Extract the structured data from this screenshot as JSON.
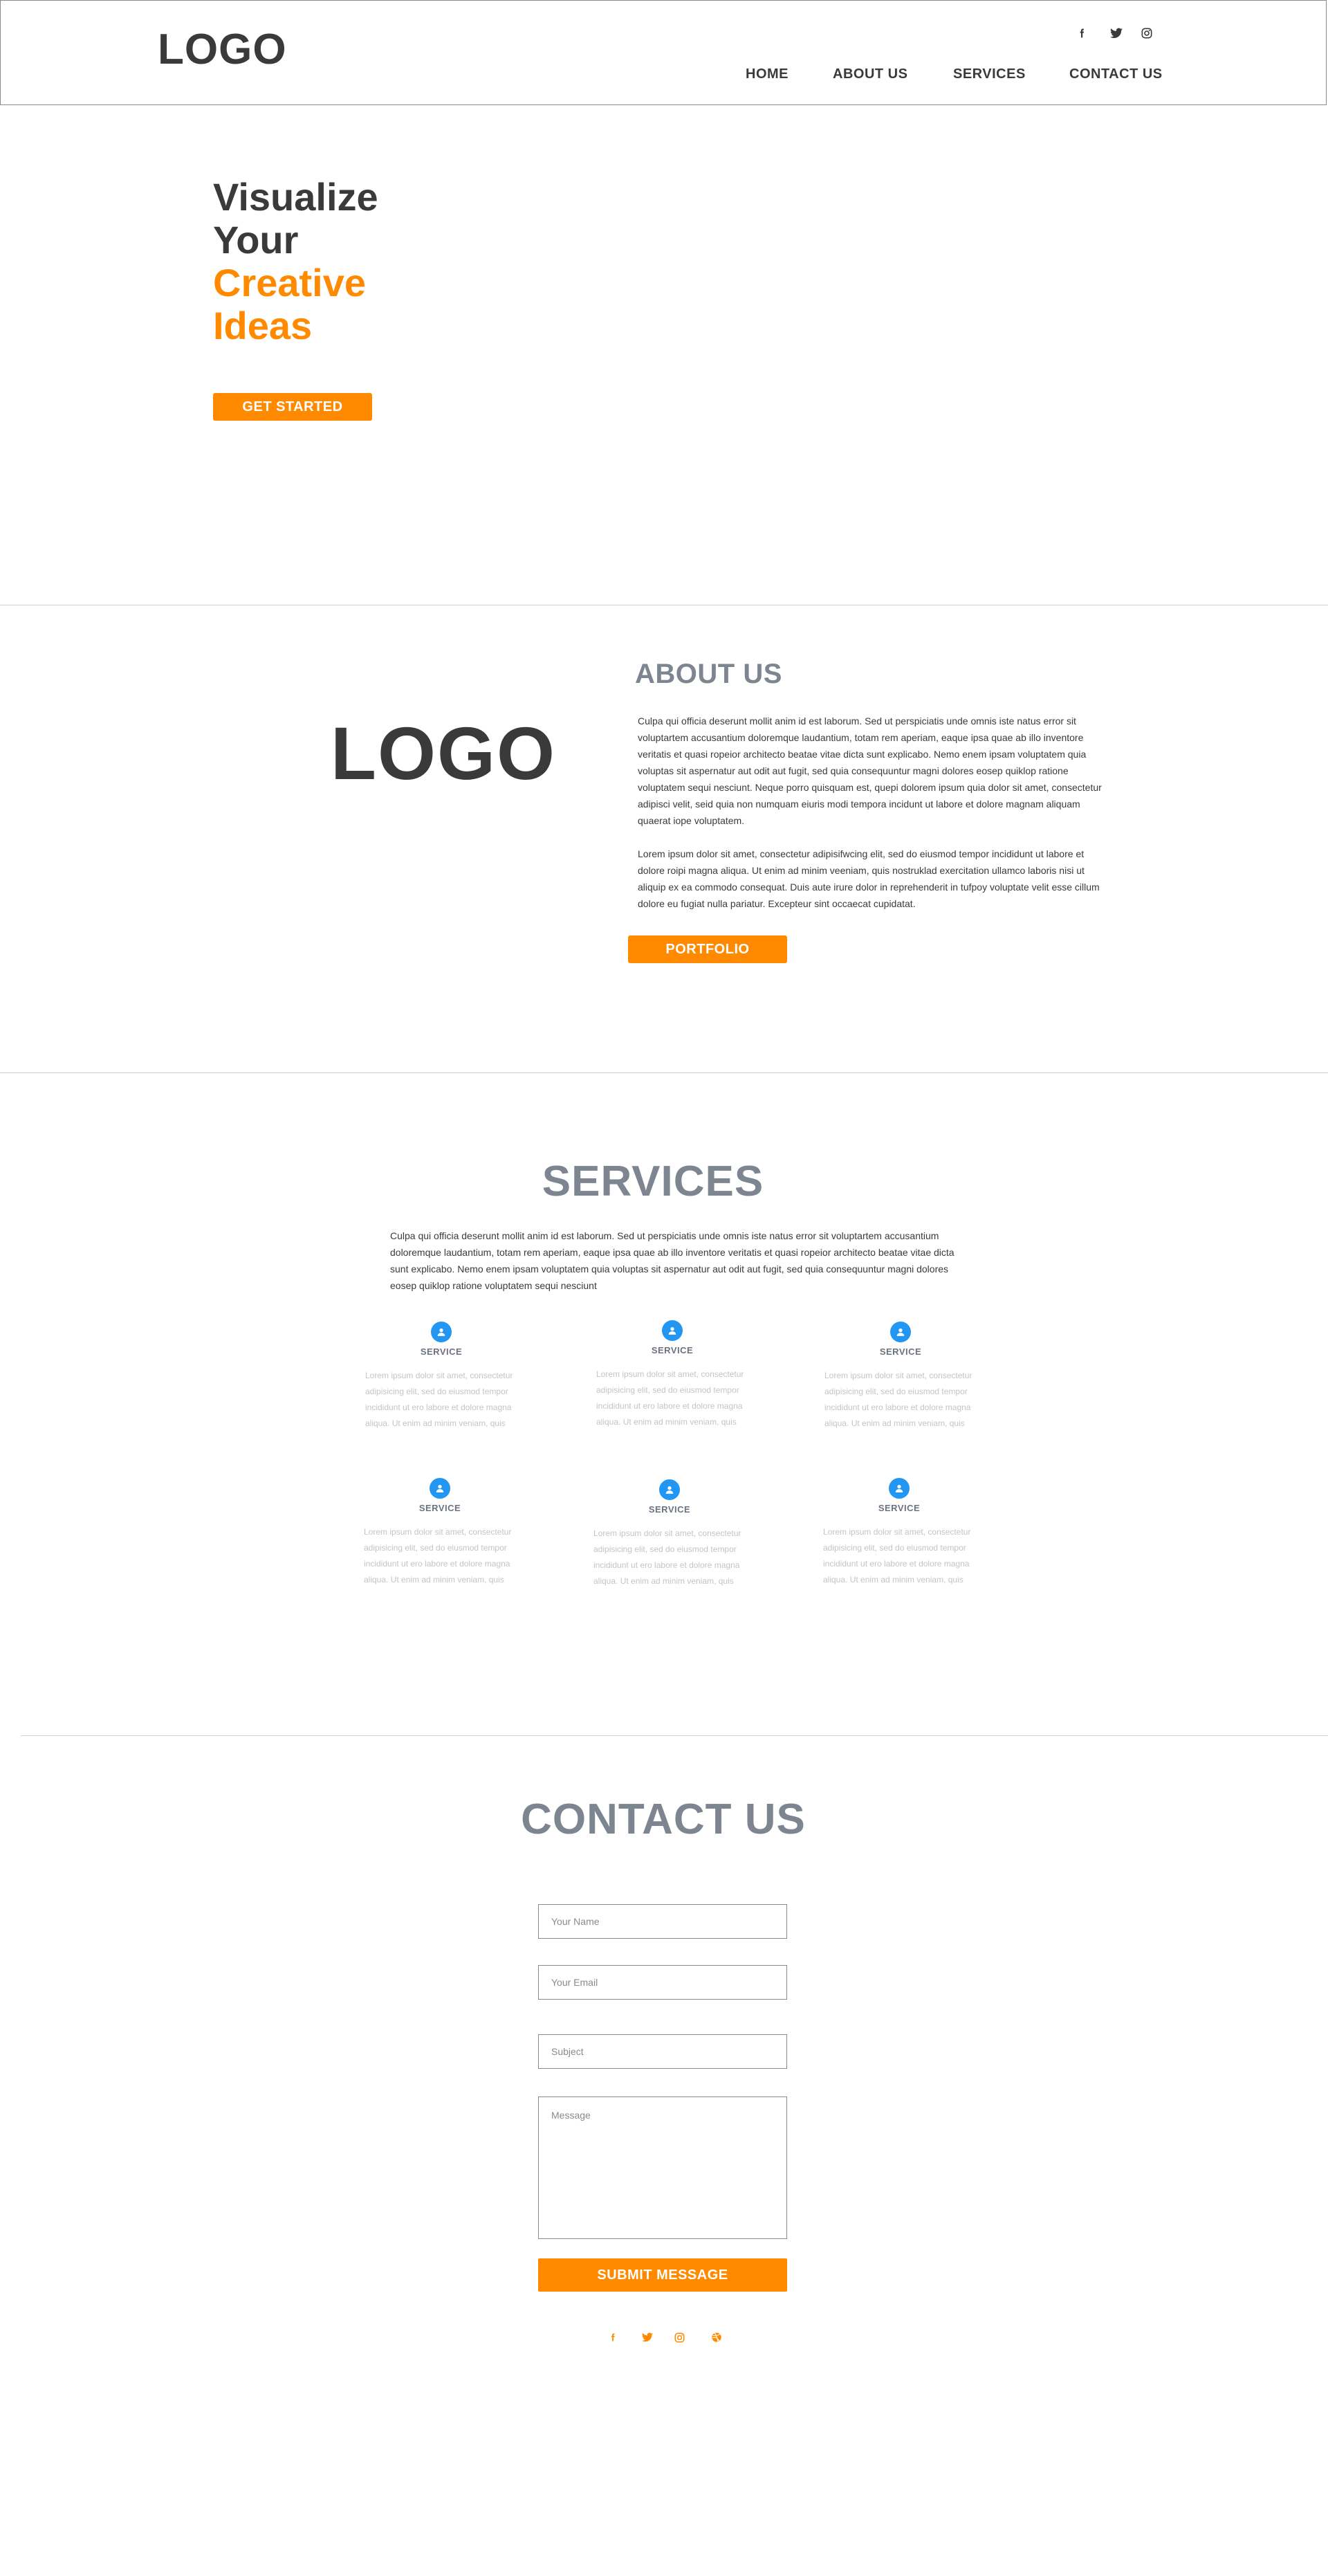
{
  "colors": {
    "accent": "#ff8a00",
    "text_dark": "#3a3a3a",
    "heading_gray": "#7d8590",
    "icon_blue": "#2196f3"
  },
  "header": {
    "logo": "LOGO",
    "nav": [
      "HOME",
      "ABOUT US",
      "SERVICES",
      "CONTACT US"
    ],
    "social_icons": [
      "facebook-icon",
      "twitter-icon",
      "instagram-icon"
    ]
  },
  "hero": {
    "line1": "Visualize",
    "line2": "Your",
    "line3": "Creative",
    "line4": "Ideas",
    "cta": "GET STARTED"
  },
  "about": {
    "logo": "LOGO",
    "title": "ABOUT US",
    "paragraph1": "Culpa qui officia deserunt mollit anim id est laborum. Sed ut perspiciatis unde omnis iste natus error sit voluptartem accusantium doloremque laudantium, totam rem aperiam, eaque ipsa quae ab illo inventore veritatis et quasi ropeior architecto beatae vitae dicta sunt explicabo. Nemo enem ipsam voluptatem quia voluptas sit aspernatur aut odit aut fugit, sed quia consequuntur magni dolores eosep quiklop ratione voluptatem sequi nesciunt. Neque porro quisquam est, quepi dolorem ipsum quia dolor sit amet, consectetur adipisci velit, seid quia non numquam eiuris modi tempora incidunt ut labore et dolore magnam aliquam quaerat iope voluptatem.",
    "paragraph2": "Lorem ipsum dolor sit amet, consectetur adipisifwcing elit, sed do eiusmod tempor incididunt ut labore et dolore roipi magna aliqua. Ut enim ad minim veeniam, quis nostruklad exercitation ullamco laboris nisi ut aliquip ex ea commodo consequat. Duis aute irure dolor in reprehenderit in tufpoy voluptate velit esse cillum dolore eu fugiat nulla pariatur. Excepteur sint occaecat cupidatat.",
    "cta": "PORTFOLIO"
  },
  "services": {
    "title": "SERVICES",
    "intro": "Culpa qui officia deserunt mollit anim id est laborum. Sed ut perspiciatis unde omnis iste natus error sit voluptartem accusantium doloremque laudantium, totam rem aperiam, eaque ipsa quae ab illo inventore veritatis et quasi ropeior architecto beatae vitae dicta sunt explicabo. Nemo enem ipsam voluptatem quia voluptas sit aspernatur aut odit aut fugit, sed quia consequuntur magni dolores eosep quiklop ratione voluptatem sequi nesciunt",
    "items": [
      {
        "icon": "user-icon",
        "title": "SERVICE",
        "desc": "Lorem ipsum dolor sit amet, consectetur adipisicing elit, sed do eiusmod tempor incididunt ut ero labore et dolore magna aliqua. Ut enim ad minim veniam, quis"
      },
      {
        "icon": "user-icon",
        "title": "SERVICE",
        "desc": "Lorem ipsum dolor sit amet, consectetur adipisicing elit, sed do eiusmod tempor incididunt ut ero labore et dolore magna aliqua. Ut enim ad minim veniam, quis"
      },
      {
        "icon": "user-icon",
        "title": "SERVICE",
        "desc": "Lorem ipsum dolor sit amet, consectetur adipisicing elit, sed do eiusmod tempor incididunt ut ero labore et dolore magna aliqua. Ut enim ad minim veniam, quis"
      },
      {
        "icon": "user-icon",
        "title": "SERVICE",
        "desc": "Lorem ipsum dolor sit amet, consectetur adipisicing elit, sed do eiusmod tempor incididunt ut ero labore et dolore magna aliqua. Ut enim ad minim veniam, quis"
      },
      {
        "icon": "user-icon",
        "title": "SERVICE",
        "desc": "Lorem ipsum dolor sit amet, consectetur adipisicing elit, sed do eiusmod tempor incididunt ut ero labore et dolore magna aliqua. Ut enim ad minim veniam, quis"
      },
      {
        "icon": "user-icon",
        "title": "SERVICE",
        "desc": "Lorem ipsum dolor sit amet, consectetur adipisicing elit, sed do eiusmod tempor incididunt ut ero labore et dolore magna aliqua. Ut enim ad minim veniam, quis"
      }
    ]
  },
  "contact": {
    "title": "CONTACT US",
    "name_placeholder": "Your Name",
    "email_placeholder": "Your Email",
    "subject_placeholder": "Subject",
    "message_placeholder": "Message",
    "submit": "SUBMIT MESSAGE",
    "social_icons": [
      "facebook-icon",
      "twitter-icon",
      "instagram-icon",
      "dribbble-icon"
    ]
  }
}
